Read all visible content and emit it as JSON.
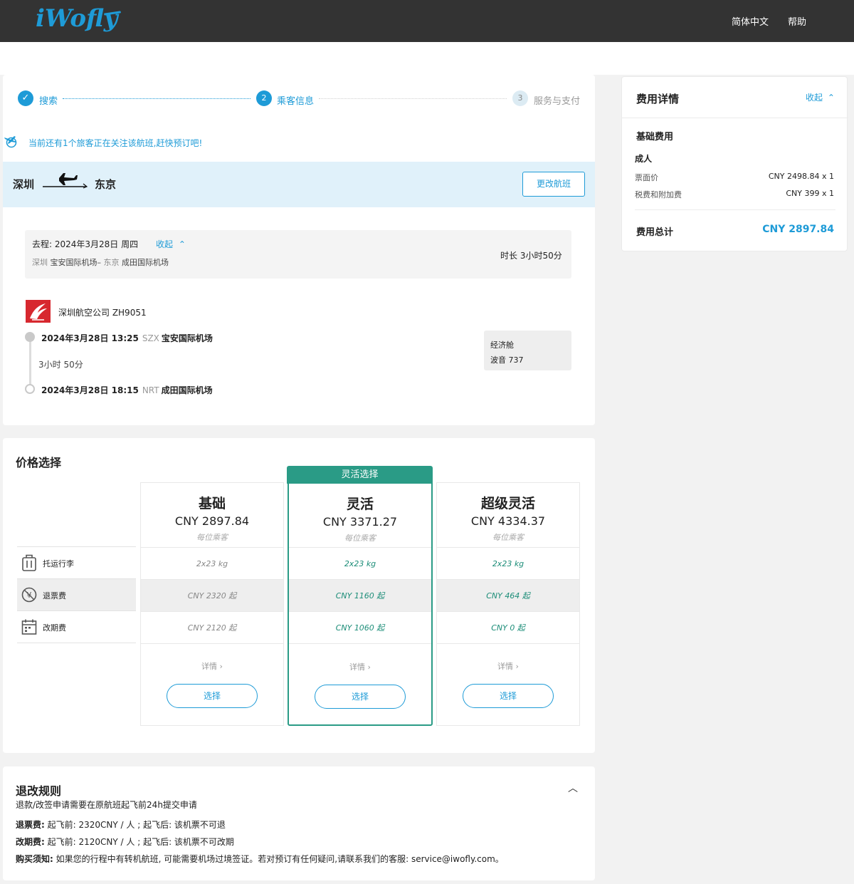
{
  "header": {
    "logo": "iWofly",
    "nav": [
      "简体中文",
      "帮助"
    ]
  },
  "steps": [
    {
      "num": "✓",
      "label": "搜索",
      "state": "done"
    },
    {
      "num": "2",
      "label": "乘客信息",
      "state": "active"
    },
    {
      "num": "3",
      "label": "服务与支付",
      "state": "pending"
    }
  ],
  "notice": "当前还有1个旅客正在关注该航班,赶快预订吧!",
  "route": {
    "from": "深圳",
    "to": "东京",
    "change_label": "更改航班"
  },
  "segment": {
    "title": "去程: 2024年3月28日 周四",
    "collapse_label": "收起",
    "from_city": "深圳",
    "from_airport": "宝安国际机场",
    "sep": "–",
    "to_city": "东京",
    "to_airport": "成田国际机场",
    "duration": "时长 3小时50分"
  },
  "flight": {
    "airline": "深圳航空公司 ZH9051",
    "depart": {
      "datetime": "2024年3月28日 13:25",
      "code": "SZX",
      "airport": "宝安国际机场"
    },
    "duration": "3小时 50分",
    "arrive": {
      "datetime": "2024年3月28日 18:15",
      "code": "NRT",
      "airport": "成田国际机场"
    },
    "cabin": "经济舱",
    "aircraft": "波音 737"
  },
  "price_section": {
    "title": "价格选择",
    "selected_tag": "灵活选择",
    "features": [
      {
        "icon": "luggage-icon",
        "label": "托运行李"
      },
      {
        "icon": "refund-icon",
        "label": "退票费"
      },
      {
        "icon": "calendar-icon",
        "label": "改期费"
      }
    ],
    "fares": [
      {
        "name": "基础",
        "price": "CNY 2897.84",
        "per": "每位乘客",
        "baggage": "2x23 kg",
        "refund": "CNY 2320 起",
        "change": "CNY 2120 起",
        "detail": "详情 ›",
        "select": "选择"
      },
      {
        "name": "灵活",
        "price": "CNY 3371.27",
        "per": "每位乘客",
        "baggage": "2x23 kg",
        "refund": "CNY 1160 起",
        "change": "CNY 1060 起",
        "detail": "详情 ›",
        "select": "选择"
      },
      {
        "name": "超级灵活",
        "price": "CNY 4334.37",
        "per": "每位乘客",
        "baggage": "2x23 kg",
        "refund": "CNY 464 起",
        "change": "CNY 0 起",
        "detail": "详情 ›",
        "select": "选择"
      }
    ]
  },
  "rules": {
    "title": "退改规则",
    "subtitle": "退款/改签申请需要在原航班起飞前24h提交申请",
    "refund_label": "退票费:",
    "refund_text": "起飞前: 2320CNY / 人 ; 起飞后: 该机票不可退",
    "change_label": "改期费:",
    "change_text": "起飞前: 2120CNY / 人 ; 起飞后: 该机票不可改期",
    "notice_label": "购买须知:",
    "notice_text": "如果您的行程中有转机航班, 可能需要机场过境签证。若对预订有任何疑问,请联系我们的客服: service@iwofly.com。"
  },
  "fee_detail": {
    "title": "费用详情",
    "collapse_label": "收起",
    "base_title": "基础费用",
    "pax_type": "成人",
    "ticket_label": "票面价",
    "ticket_value": "CNY 2498.84 x 1",
    "tax_label": "税费和附加费",
    "tax_value": "CNY 399 x 1",
    "total_label": "费用总计",
    "total_value": "CNY 2897.84"
  },
  "colors": {
    "accent": "#1e9bd7",
    "selected": "#2a9b86",
    "topbar": "#333333"
  }
}
